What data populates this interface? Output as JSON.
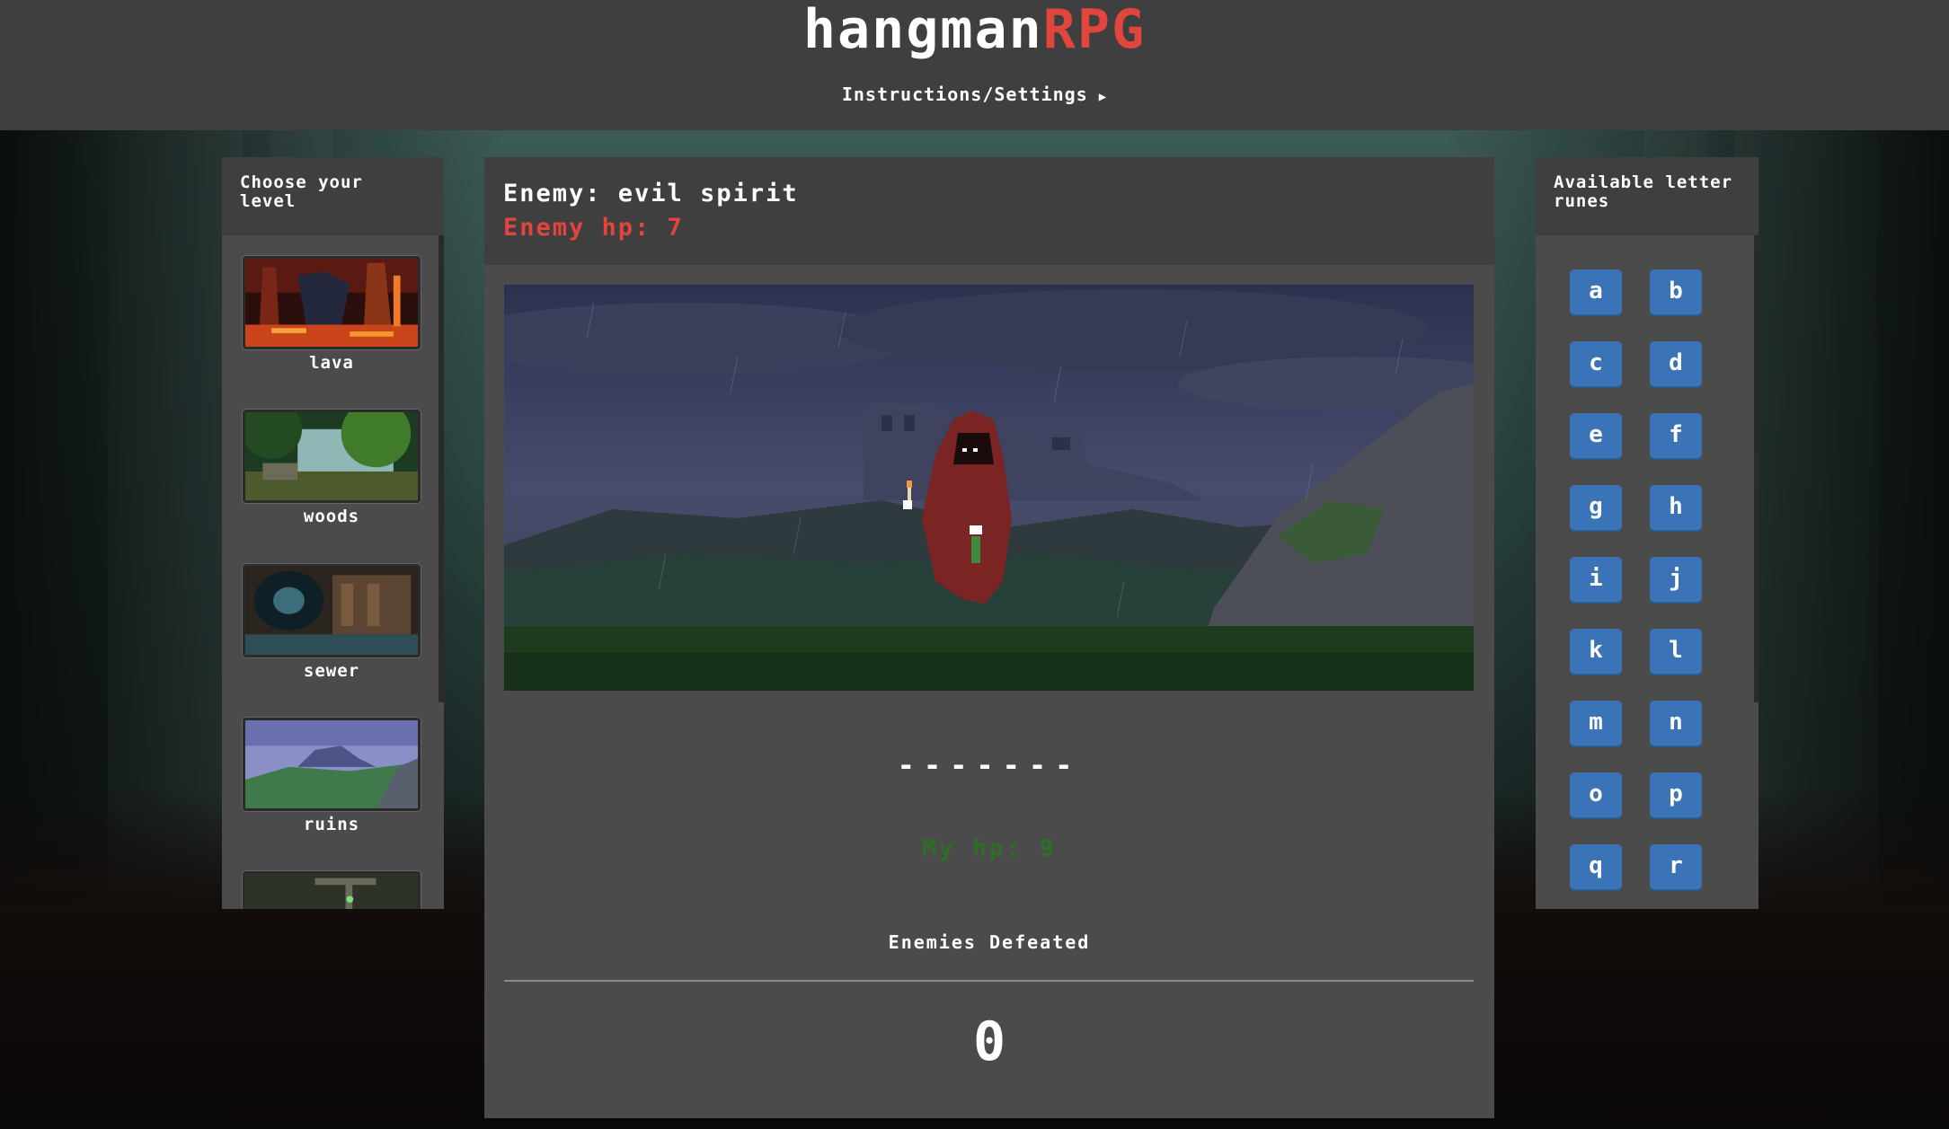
{
  "header": {
    "logo_part1": "hangman",
    "logo_part2": "RPG",
    "settings_link": "Instructions/Settings"
  },
  "levels_panel": {
    "title": "Choose your level",
    "levels": [
      {
        "label": "lava"
      },
      {
        "label": "woods"
      },
      {
        "label": "sewer"
      },
      {
        "label": "ruins"
      },
      {
        "label": ""
      }
    ]
  },
  "enemy": {
    "name": "Enemy: evil spirit",
    "hp": "Enemy hp: 7",
    "sprite_icon": "hooded-spirit-icon"
  },
  "game": {
    "word_mask": "-------",
    "my_hp": "My hp: 9",
    "defeated_label": "Enemies Defeated",
    "defeated_count": "0"
  },
  "runes_panel": {
    "title": "Available letter runes",
    "letters": [
      "a",
      "b",
      "c",
      "d",
      "e",
      "f",
      "g",
      "h",
      "i",
      "j",
      "k",
      "l",
      "m",
      "n",
      "o",
      "p",
      "q",
      "r"
    ]
  },
  "colors": {
    "header_bg": "#3f3f3f",
    "panel_bg": "#4b4b4b",
    "accent_red": "#e0463c",
    "rune_blue": "#3a74b7",
    "hp_green": "#2f6e27"
  }
}
